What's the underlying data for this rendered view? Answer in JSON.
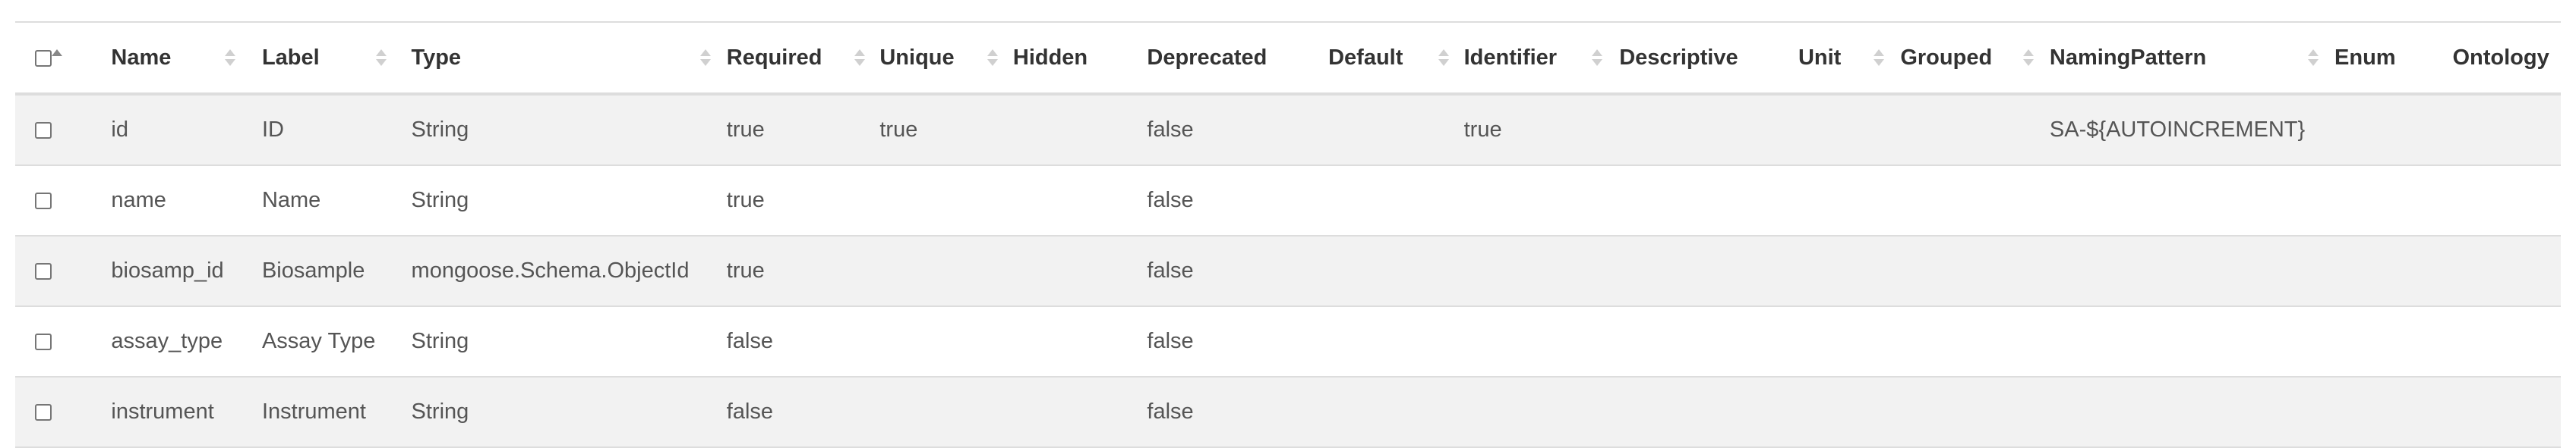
{
  "table": {
    "columns": [
      {
        "key": "select",
        "label": ""
      },
      {
        "key": "name",
        "label": "Name"
      },
      {
        "key": "label",
        "label": "Label"
      },
      {
        "key": "type",
        "label": "Type"
      },
      {
        "key": "required",
        "label": "Required"
      },
      {
        "key": "unique",
        "label": "Unique"
      },
      {
        "key": "hidden",
        "label": "Hidden"
      },
      {
        "key": "deprecated",
        "label": "Deprecated"
      },
      {
        "key": "default",
        "label": "Default"
      },
      {
        "key": "identifier",
        "label": "Identifier"
      },
      {
        "key": "descriptive",
        "label": "Descriptive"
      },
      {
        "key": "unit",
        "label": "Unit"
      },
      {
        "key": "grouped",
        "label": "Grouped"
      },
      {
        "key": "namingpattern",
        "label": "NamingPattern"
      },
      {
        "key": "enum",
        "label": "Enum"
      },
      {
        "key": "ontology",
        "label": "Ontology"
      }
    ],
    "rows": [
      {
        "name": "id",
        "label": "ID",
        "type": "String",
        "required": "true",
        "unique": "true",
        "hidden": "",
        "deprecated": "false",
        "default": "",
        "identifier": "true",
        "descriptive": "",
        "unit": "",
        "grouped": "",
        "namingpattern": "SA-${AUTOINCREMENT}",
        "enum": "",
        "ontology": ""
      },
      {
        "name": "name",
        "label": "Name",
        "type": "String",
        "required": "true",
        "unique": "",
        "hidden": "",
        "deprecated": "false",
        "default": "",
        "identifier": "",
        "descriptive": "",
        "unit": "",
        "grouped": "",
        "namingpattern": "",
        "enum": "",
        "ontology": ""
      },
      {
        "name": "biosamp_id",
        "label": "Biosample",
        "type": "mongoose.Schema.ObjectId",
        "required": "true",
        "unique": "",
        "hidden": "",
        "deprecated": "false",
        "default": "",
        "identifier": "",
        "descriptive": "",
        "unit": "",
        "grouped": "",
        "namingpattern": "",
        "enum": "",
        "ontology": ""
      },
      {
        "name": "assay_type",
        "label": "Assay Type",
        "type": "String",
        "required": "false",
        "unique": "",
        "hidden": "",
        "deprecated": "false",
        "default": "",
        "identifier": "",
        "descriptive": "",
        "unit": "",
        "grouped": "",
        "namingpattern": "",
        "enum": "",
        "ontology": ""
      },
      {
        "name": "instrument",
        "label": "Instrument",
        "type": "String",
        "required": "false",
        "unique": "",
        "hidden": "",
        "deprecated": "false",
        "default": "",
        "identifier": "",
        "descriptive": "",
        "unit": "",
        "grouped": "",
        "namingpattern": "",
        "enum": "",
        "ontology": ""
      }
    ]
  },
  "colors": {
    "stripe": "#f2f2f2",
    "border": "#dddddd",
    "sort_inactive": "#d0d0d0",
    "sort_active": "#888888"
  },
  "icons": {
    "sort": "sort-both-icon",
    "sort_active": "sort-asc-icon"
  }
}
